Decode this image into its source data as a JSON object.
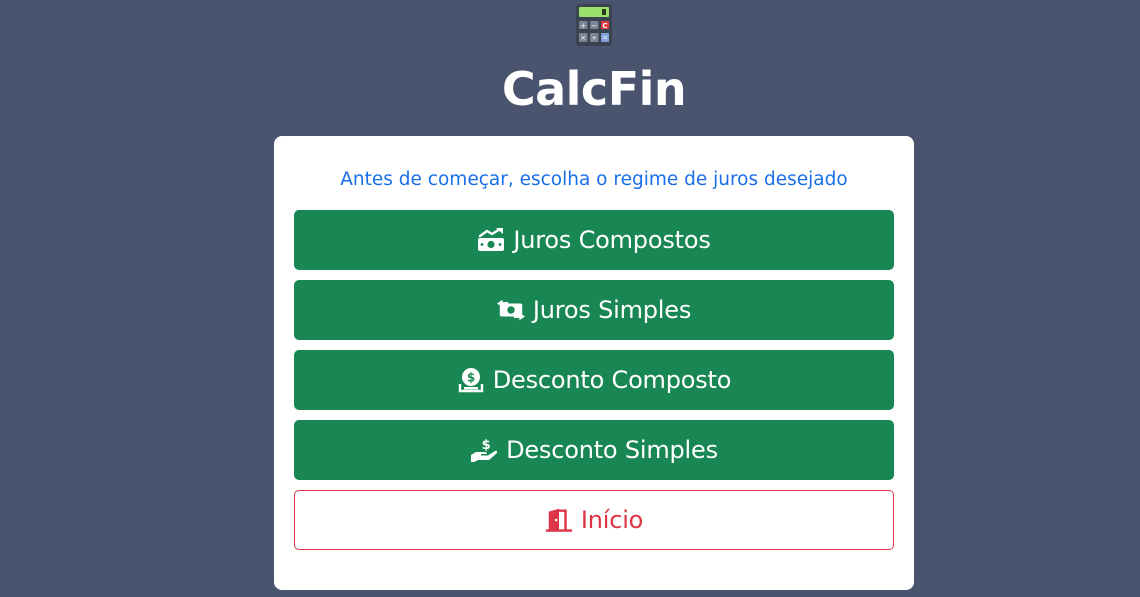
{
  "app": {
    "title": "CalcFin",
    "logo_icon": "calculator-icon"
  },
  "card": {
    "prompt": "Antes de começar, escolha o regime de juros desejado",
    "buttons": [
      {
        "label": "Juros Compostos",
        "icon": "money-bill-trend-up-icon"
      },
      {
        "label": "Juros Simples",
        "icon": "money-bill-transfer-icon"
      },
      {
        "label": "Desconto Composto",
        "icon": "sack-dollar-icon"
      },
      {
        "label": "Desconto Simples",
        "icon": "hand-holding-dollar-icon"
      },
      {
        "label": "Início",
        "icon": "door-open-icon"
      }
    ]
  },
  "colors": {
    "background": "#4a546e",
    "prompt": "#1a6ee8",
    "success": "#198754",
    "danger": "#dc3545"
  }
}
